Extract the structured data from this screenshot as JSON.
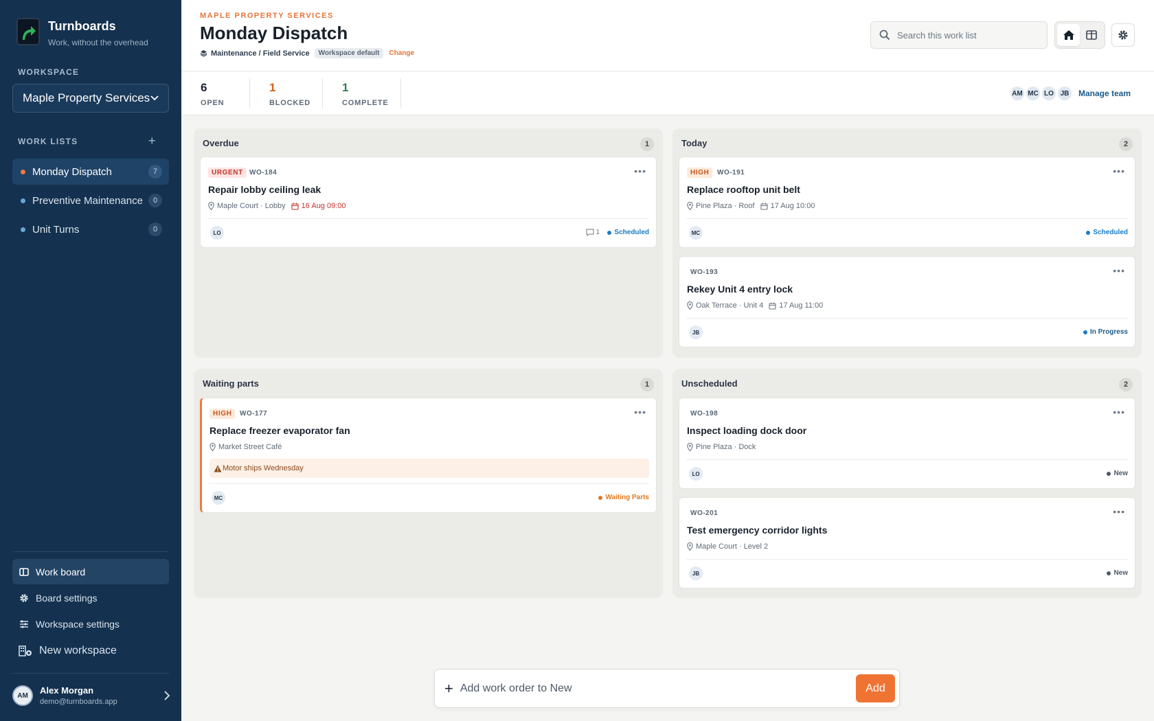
{
  "brand": {
    "name": "Turnboards",
    "tagline": "Work, without the overhead"
  },
  "sidebar": {
    "workspace_label": "WORKSPACE",
    "workspace_selected": "Maple Property Services",
    "worklists_label": "WORK LISTS",
    "worklists": [
      {
        "label": "Monday Dispatch",
        "count": "7"
      },
      {
        "label": "Preventive Maintenance",
        "count": "0"
      },
      {
        "label": "Unit Turns",
        "count": "0"
      }
    ],
    "nav": [
      {
        "label": "Work board"
      },
      {
        "label": "Board settings"
      },
      {
        "label": "Workspace settings"
      },
      {
        "label": "New workspace"
      }
    ],
    "user": {
      "initials": "AM",
      "name": "Alex Morgan",
      "email": "demo@turnboards.app"
    }
  },
  "header": {
    "kicker": "MAPLE PROPERTY SERVICES",
    "title": "Monday Dispatch",
    "category": "Maintenance / Field Service",
    "pill": "Workspace default",
    "change": "Change",
    "search_placeholder": "Search this work list"
  },
  "stats": [
    {
      "num": "6",
      "label": "OPEN",
      "color": "#1b2430"
    },
    {
      "num": "1",
      "label": "BLOCKED",
      "color": "#d2601f"
    },
    {
      "num": "1",
      "label": "COMPLETE",
      "color": "#2e7d4f"
    }
  ],
  "team": {
    "members": [
      "AM",
      "MC",
      "LO",
      "JB"
    ],
    "manage_label": "Manage team"
  },
  "columns": {
    "overdue": {
      "title": "Overdue",
      "count": "1",
      "cards": [
        {
          "badge": "URGENT",
          "id": "WO-184",
          "title": "Repair lobby ceiling leak",
          "location": "Maple Court · Lobby",
          "date": "16 Aug 09:00",
          "assignee": "LO",
          "comments": "1",
          "status": "Scheduled",
          "status_color": "#1a7bc4"
        }
      ]
    },
    "today": {
      "title": "Today",
      "count": "2",
      "cards": [
        {
          "badge": "HIGH",
          "id": "WO-191",
          "title": "Replace rooftop unit belt",
          "location": "Pine Plaza · Roof",
          "date": "17 Aug 10:00",
          "assignee": "MC",
          "status": "Scheduled",
          "status_color": "#1a7bc4"
        },
        {
          "id": "WO-193",
          "title": "Rekey Unit 4 entry lock",
          "location": "Oak Terrace · Unit 4",
          "date": "17 Aug 11:00",
          "assignee": "JB",
          "status": "In Progress",
          "status_color": "#1d5a8a"
        }
      ]
    },
    "waiting": {
      "title": "Waiting parts",
      "count": "1",
      "cards": [
        {
          "badge": "HIGH",
          "id": "WO-177",
          "title": "Replace freezer evaporator fan",
          "location": "Market Street Café",
          "warning": "Motor ships Wednesday",
          "assignee": "MC",
          "status": "Waiting Parts",
          "status_color": "#e07a1f"
        }
      ]
    },
    "unscheduled": {
      "title": "Unscheduled",
      "count": "2",
      "cards": [
        {
          "id": "WO-198",
          "title": "Inspect loading dock door",
          "location": "Pine Plaza · Dock",
          "assignee": "LO",
          "status": "New",
          "status_color": "#4d5968"
        },
        {
          "id": "WO-201",
          "title": "Test emergency corridor lights",
          "location": "Maple Court · Level 2",
          "assignee": "JB",
          "status": "New",
          "status_color": "#4d5968"
        }
      ]
    }
  },
  "addbar": {
    "placeholder": "Add work order to New",
    "button": "Add"
  },
  "colors": {
    "accent": "#ef7434",
    "sidebar": "#14314f"
  }
}
